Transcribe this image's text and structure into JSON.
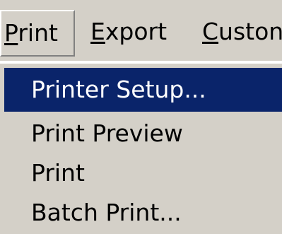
{
  "menubar": {
    "items": [
      {
        "accel": "P",
        "rest": "rint"
      },
      {
        "accel": "E",
        "rest": "xport"
      },
      {
        "accel": "C",
        "rest": "uston"
      }
    ]
  },
  "dropdown": {
    "items": [
      {
        "label": "Printer Setup..."
      },
      {
        "label": "Print Preview"
      },
      {
        "label": "Print"
      },
      {
        "label": "Batch Print..."
      }
    ]
  },
  "colors": {
    "face": "#d4d0c8",
    "highlight": "#0a246a",
    "highlight_text": "#ffffff"
  }
}
